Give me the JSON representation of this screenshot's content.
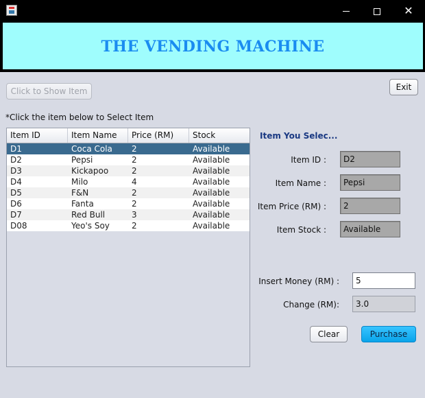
{
  "window": {
    "title": ""
  },
  "header": {
    "title": "THE VENDING MACHINE"
  },
  "toolbar": {
    "show_item_label": "Click to Show Item",
    "exit_label": "Exit"
  },
  "instruction": "*Click the item below to Select Item",
  "table": {
    "columns": [
      "Item ID",
      "Item Name",
      "Price (RM)",
      "Stock"
    ],
    "rows": [
      [
        "D1",
        "Coca Cola",
        "2",
        "Available"
      ],
      [
        "D2",
        "Pepsi",
        "2",
        "Available"
      ],
      [
        "D3",
        "Kickapoo",
        "2",
        "Available"
      ],
      [
        "D4",
        "Milo",
        "4",
        "Available"
      ],
      [
        "D5",
        "F&N",
        "2",
        "Available"
      ],
      [
        "D6",
        "Fanta",
        "2",
        "Available"
      ],
      [
        "D7",
        "Red Bull",
        "3",
        "Available"
      ],
      [
        "D08",
        "Yeo's Soy",
        "2",
        "Available"
      ]
    ]
  },
  "selection": {
    "title": "Item You Selec...",
    "item_id_label": "Item ID :",
    "item_id_value": "D2",
    "item_name_label": "Item Name :",
    "item_name_value": "Pepsi",
    "item_price_label": "Item Price (RM) :",
    "item_price_value": "2",
    "item_stock_label": "Item Stock :",
    "item_stock_value": "Available"
  },
  "payment": {
    "insert_money_label": "Insert Money (RM) :",
    "insert_money_value": "5",
    "change_label": "Change (RM):",
    "change_value": "3.0"
  },
  "actions": {
    "clear_label": "Clear",
    "purchase_label": "Purchase"
  }
}
